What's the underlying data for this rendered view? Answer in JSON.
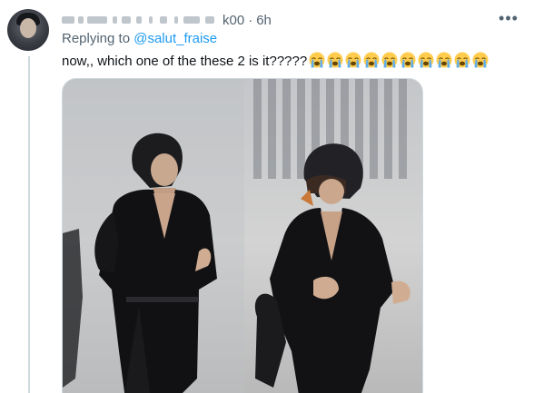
{
  "tweet": {
    "handle_suffix": "k00",
    "separator": "·",
    "time": "6h",
    "more_label": "•••",
    "replying_prefix": "Replying to",
    "mention": "@salut_fraise",
    "text": "now,, which one of the these 2 is it?????",
    "emoji_name": "loudly-crying-face",
    "emoji_count": 10
  },
  "colors": {
    "secondary_text": "#536471",
    "link": "#1d9bf0",
    "primary_text": "#0f1419",
    "border": "#cfd9de"
  },
  "media": {
    "kind": "photo",
    "content": "two performers in black suits on stage"
  }
}
